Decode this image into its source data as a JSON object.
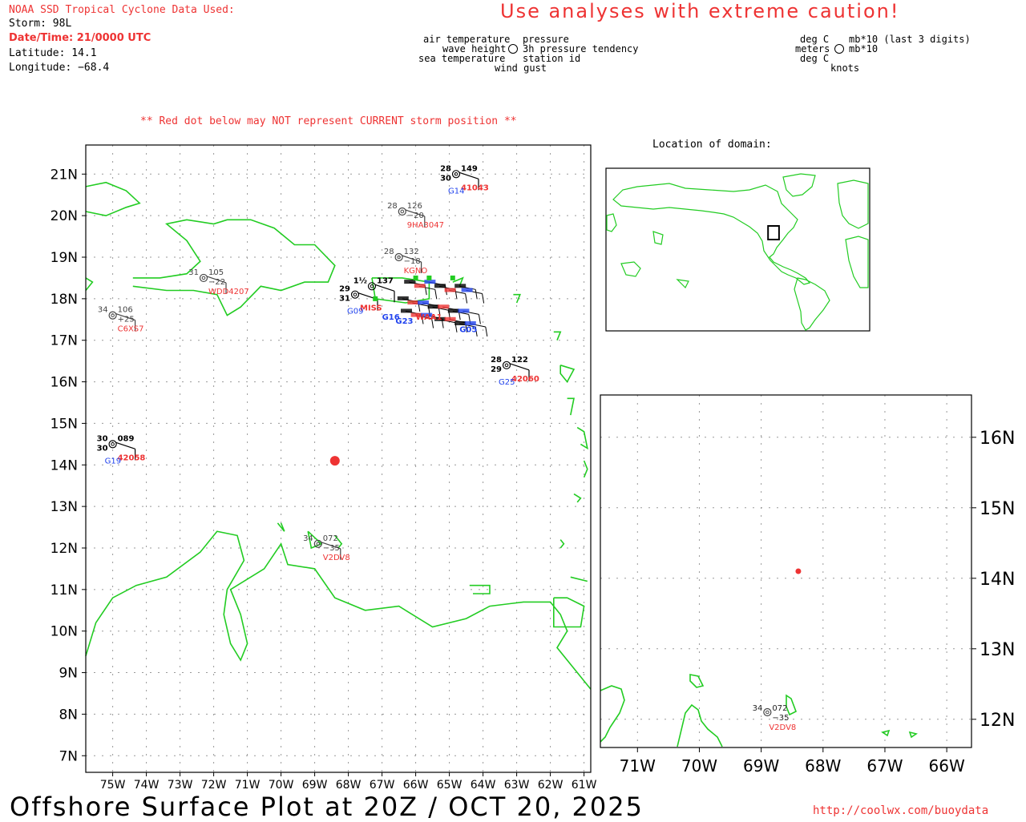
{
  "header": {
    "source": "NOAA SSD Tropical Cyclone Data Used:",
    "storm": "Storm: 98L",
    "datetime": "Date/Time: 21/0000 UTC",
    "latitude": "Latitude: 14.1",
    "longitude": "Longitude: −68.4",
    "caution": "Use analyses with extreme caution!"
  },
  "legend_left": {
    "air_temperature": "air temperature",
    "wave_height": "wave height",
    "sea_temperature": "sea temperature",
    "pressure": "pressure",
    "pressure_tendency": "3h pressure tendency",
    "station_id": "station id",
    "wind_gust": "wind gust"
  },
  "legend_right": {
    "deg_c_1": "deg C",
    "meters": "meters",
    "deg_c_2": "deg C",
    "mb_last3": "mb*10 (last 3 digits)",
    "mb": "mb*10",
    "knots": "knots"
  },
  "warning": "** Red dot below may NOT represent CURRENT storm position **",
  "inset_title": "Location of domain:",
  "bottom_title": "Offshore Surface Plot at 20Z / OCT 20, 2025",
  "url": "http://coolwx.com/buoydata",
  "colors": {
    "land": "#22cc22",
    "grid": "#999999",
    "red": "#ee3333",
    "blue": "#2244ee",
    "black": "#000000"
  },
  "main_map": {
    "lat_labels": [
      "21N",
      "20N",
      "19N",
      "18N",
      "17N",
      "16N",
      "15N",
      "14N",
      "13N",
      "12N",
      "11N",
      "10N",
      "9N",
      "8N",
      "7N"
    ],
    "lon_labels": [
      "75W",
      "74W",
      "73W",
      "72W",
      "71W",
      "70W",
      "69W",
      "68W",
      "67W",
      "66W",
      "65W",
      "64W",
      "63W",
      "62W",
      "61W"
    ],
    "lat_range": [
      6.6,
      21.7
    ],
    "lon_range": [
      -75.8,
      -60.8
    ],
    "storm_position": {
      "lat": 14.1,
      "lon": -68.4
    },
    "stations": [
      {
        "id": "41043",
        "lat": 21.0,
        "lon": -64.8,
        "air": "28",
        "sea": "30",
        "pres": "149",
        "tend": "",
        "wave": "",
        "gust": "G14",
        "color": "black",
        "id_color": "red"
      },
      {
        "id": "9HA3047",
        "lat": 20.1,
        "lon": -66.4,
        "air": "28",
        "sea": "",
        "pres": "126",
        "tend": "−20",
        "wave": "",
        "gust": "",
        "color": "gray",
        "id_color": "red"
      },
      {
        "id": "KGNO",
        "lat": 19.0,
        "lon": -66.5,
        "air": "28",
        "sea": "",
        "pres": "132",
        "tend": "−18",
        "wave": "",
        "gust": "",
        "color": "gray",
        "id_color": "red"
      },
      {
        "id": "WDD4207",
        "lat": 18.5,
        "lon": -72.3,
        "air": "31",
        "sea": "",
        "pres": "105",
        "tend": "−22",
        "wave": "",
        "gust": "",
        "color": "gray",
        "id_color": "red"
      },
      {
        "id": "C6XS7",
        "lat": 17.6,
        "lon": -75.0,
        "air": "34",
        "sea": "",
        "pres": "106",
        "tend": "+25",
        "wave": "",
        "gust": "",
        "color": "gray",
        "id_color": "red"
      },
      {
        "id": "",
        "lat": 18.3,
        "lon": -67.3,
        "air": "1½",
        "sea": "",
        "pres": "137",
        "tend": "",
        "wave": "",
        "gust": "",
        "color": "black",
        "id_color": "red"
      },
      {
        "id": "MISS",
        "lat": 18.1,
        "lon": -67.8,
        "air": "29",
        "sea": "31",
        "pres": "",
        "tend": "",
        "wave": "",
        "gust": "G09",
        "color": "black",
        "id_color": "red"
      },
      {
        "id": "42060",
        "lat": 16.4,
        "lon": -63.3,
        "air": "28",
        "sea": "29",
        "pres": "122",
        "tend": "",
        "wave": "",
        "gust": "G25",
        "color": "black",
        "id_color": "red"
      },
      {
        "id": "42058",
        "lat": 14.5,
        "lon": -75.0,
        "air": "30",
        "sea": "30",
        "pres": "089",
        "tend": "",
        "wave": "",
        "gust": "G19",
        "color": "black",
        "id_color": "red"
      },
      {
        "id": "V2DV8",
        "lat": 12.1,
        "lon": -68.9,
        "air": "34",
        "sea": "",
        "pres": "072",
        "tend": "−35",
        "wave": "",
        "gust": "",
        "color": "gray",
        "id_color": "red"
      }
    ],
    "cluster_labels": [
      {
        "text": "G16",
        "lat": 17.5,
        "lon": -67.0,
        "color": "blue"
      },
      {
        "text": "G23",
        "lat": 17.4,
        "lon": -66.6,
        "color": "blue"
      },
      {
        "text": "WAA1",
        "lat": 17.5,
        "lon": -66.0,
        "color": "red"
      },
      {
        "text": "G05",
        "lat": 17.2,
        "lon": -64.7,
        "color": "blue"
      }
    ]
  },
  "inset_world": {
    "lat_range": [
      -90,
      90
    ],
    "lon_range": [
      -180,
      180
    ]
  },
  "zoom_map": {
    "lat_labels": [
      "16N",
      "15N",
      "14N",
      "13N",
      "12N"
    ],
    "lon_labels": [
      "71W",
      "70W",
      "69W",
      "68W",
      "67W",
      "66W"
    ],
    "lat_range": [
      11.6,
      16.6
    ],
    "lon_range": [
      -71.6,
      -65.6
    ],
    "storm_position": {
      "lat": 14.1,
      "lon": -68.4
    },
    "station": {
      "id": "V2DV8",
      "lat": 12.1,
      "lon": -68.9,
      "air": "34",
      "pres": "072",
      "tend": "−35"
    }
  }
}
